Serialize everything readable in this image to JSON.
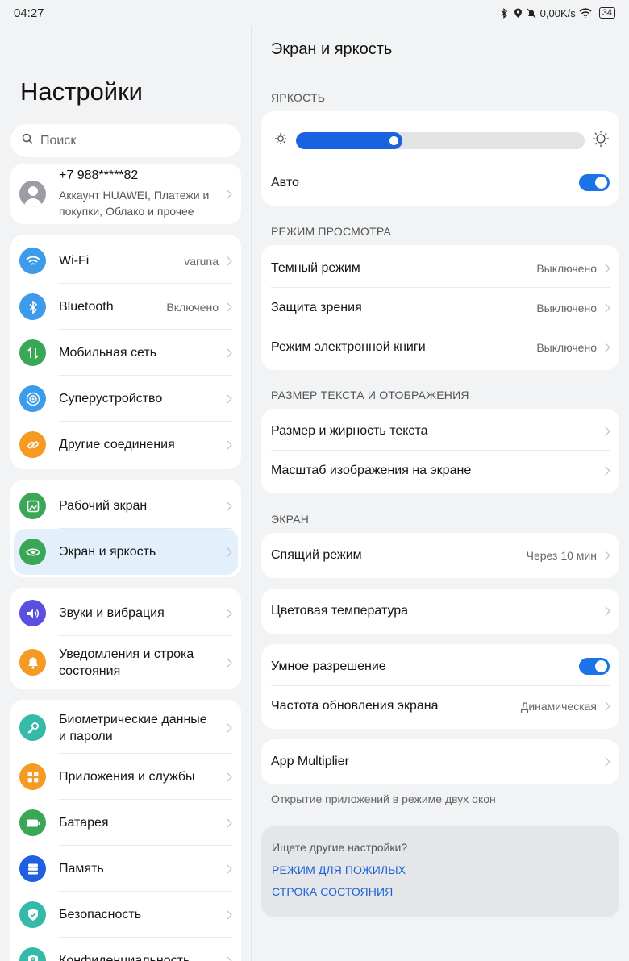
{
  "status": {
    "time": "04:27",
    "speed": "0,00K/s",
    "battery": "34"
  },
  "left": {
    "title": "Настройки",
    "search_placeholder": "Поиск",
    "account": {
      "phone": "+7 988*****82",
      "subtitle": "Аккаунт HUAWEI, Платежи и покупки, Облако и прочее"
    },
    "group1": [
      {
        "label": "Wi-Fi",
        "value": "varuna",
        "icon": "wifi-icon",
        "color": "#3d9be9"
      },
      {
        "label": "Bluetooth",
        "value": "Включено",
        "icon": "bluetooth-icon",
        "color": "#3d9be9"
      },
      {
        "label": "Мобильная сеть",
        "value": "",
        "icon": "mobile-network-icon",
        "color": "#3aa757"
      },
      {
        "label": "Суперустройство",
        "value": "",
        "icon": "super-device-icon",
        "color": "#3d9be9"
      },
      {
        "label": "Другие соединения",
        "value": "",
        "icon": "link-icon",
        "color": "#f59a23"
      }
    ],
    "group2": [
      {
        "label": "Рабочий экран",
        "icon": "home-screen-icon",
        "color": "#3aa757"
      },
      {
        "label": "Экран и яркость",
        "icon": "eye-icon",
        "color": "#3aa757"
      }
    ],
    "group3": [
      {
        "label": "Звуки и вибрация",
        "icon": "speaker-icon",
        "color": "#5b4fe0"
      },
      {
        "label": "Уведомления и строка состояния",
        "icon": "bell-icon",
        "color": "#f59a23"
      }
    ],
    "group4": [
      {
        "label": "Биометрические данные и пароли",
        "icon": "key-icon",
        "color": "#35b9a8"
      },
      {
        "label": "Приложения и службы",
        "icon": "apps-icon",
        "color": "#f59a23"
      },
      {
        "label": "Батарея",
        "icon": "battery-icon",
        "color": "#3aa757"
      },
      {
        "label": "Память",
        "icon": "storage-icon",
        "color": "#1f5fe0"
      },
      {
        "label": "Безопасность",
        "icon": "shield-icon",
        "color": "#35b9a8"
      },
      {
        "label": "Конфиденциальность",
        "icon": "privacy-icon",
        "color": "#35b9a8"
      }
    ]
  },
  "right": {
    "title": "Экран и яркость",
    "brightness_section": "ЯРКОСТЬ",
    "brightness_level": 0.37,
    "auto_label": "Авто",
    "auto_on": true,
    "view_section": "РЕЖИМ ПРОСМОТРА",
    "view_rows": [
      {
        "label": "Темный режим",
        "value": "Выключено"
      },
      {
        "label": "Защита зрения",
        "value": "Выключено"
      },
      {
        "label": "Режим электронной книги",
        "value": "Выключено"
      }
    ],
    "text_section": "РАЗМЕР ТЕКСТА И ОТОБРАЖЕНИЯ",
    "text_rows": [
      {
        "label": "Размер и жирность текста"
      },
      {
        "label": "Масштаб изображения на экране"
      }
    ],
    "screen_section": "ЭКРАН",
    "sleep": {
      "label": "Спящий режим",
      "value": "Через 10 мин"
    },
    "color_temp": "Цветовая температура",
    "smart_res": {
      "label": "Умное разрешение",
      "on": true
    },
    "refresh": {
      "label": "Частота обновления экрана",
      "value": "Динамическая"
    },
    "app_multiplier": "App Multiplier",
    "app_multiplier_note": "Открытие приложений в режиме двух окон",
    "more": {
      "question": "Ищете другие настройки?",
      "links": [
        "РЕЖИМ ДЛЯ ПОЖИЛЫХ",
        "СТРОКА СОСТОЯНИЯ"
      ]
    },
    "accent": "#1a73e8"
  }
}
